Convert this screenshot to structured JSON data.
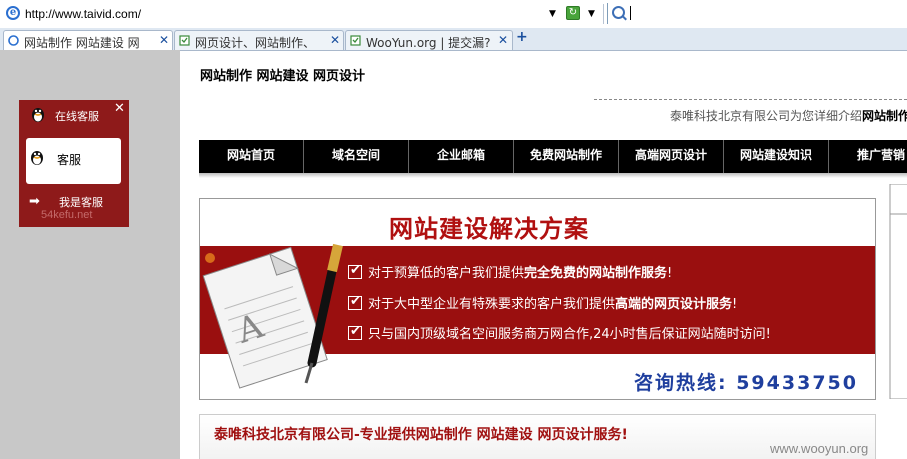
{
  "browser": {
    "url": "http://www.taivid.com/",
    "tabs": [
      {
        "label": "网站制作 网站建设 网"
      },
      {
        "label": "网页设计、网站制作、"
      },
      {
        "label": "WooYun.org | 提交漏?"
      }
    ],
    "new_tab_symbol": "+",
    "close_symbol": "✕"
  },
  "kefu": {
    "header": "在线客服",
    "close": "✕",
    "agent": "客服",
    "arrow": "➡",
    "me": "我是客服",
    "watermark": "54kefu.net"
  },
  "page": {
    "title": "网站制作  网站建设  网页设计",
    "intro_prefix": "泰唯科技北京有限公司为您详细介绍",
    "intro_bold": "网站制作"
  },
  "nav": {
    "items": [
      "网站首页",
      "域名空间",
      "企业邮箱",
      "免费网站制作",
      "高端网页设计",
      "网站建设知识",
      "推广营销"
    ]
  },
  "banner": {
    "headline": "网站建设解决方案",
    "lines": [
      {
        "pre": "对于预算低的客户我们提供",
        "bold": "完全免费的网站制作服务",
        "post": "!"
      },
      {
        "pre": "对于大中型企业有特殊要求的客户我们提供",
        "bold": "高端的网页设计服务",
        "post": "!"
      },
      {
        "pre": "只与国内顶级域名空间服务商万网合作,24小时售后保证网站随时访问!",
        "bold": "",
        "post": ""
      }
    ],
    "hotline": "咨询热线: 59433750"
  },
  "section": {
    "title": "泰唯科技北京有限公司-专业提供网站制作  网站建设  网页设计服务!"
  },
  "watermark": "www.wooyun.org",
  "colors": {
    "nav_bg": "#000000",
    "banner_red": "#9a0f0f",
    "kefu_red": "#8e1a1a",
    "hotline_blue": "#1f3f9e"
  }
}
